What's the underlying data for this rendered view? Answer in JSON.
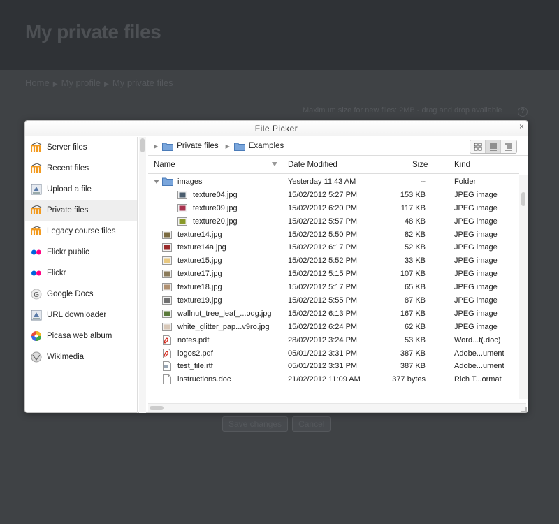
{
  "background": {
    "title": "My private files",
    "breadcrumb": [
      "Home",
      "My profile",
      "My private files"
    ],
    "max_size": "Maximum size for new files: 2MB - drag and drop available",
    "help": "?",
    "buttons": {
      "save": "Save changes",
      "cancel": "Cancel"
    }
  },
  "dialog": {
    "title": "File Picker",
    "close": "×"
  },
  "sidebar": {
    "items": [
      {
        "label": "Server files",
        "icon": "moodle-icon"
      },
      {
        "label": "Recent files",
        "icon": "moodle-icon"
      },
      {
        "label": "Upload a file",
        "icon": "upload-icon"
      },
      {
        "label": "Private files",
        "icon": "moodle-icon",
        "active": true
      },
      {
        "label": "Legacy course files",
        "icon": "moodle-icon"
      },
      {
        "label": "Flickr public",
        "icon": "flickr-icon"
      },
      {
        "label": "Flickr",
        "icon": "flickr-icon"
      },
      {
        "label": "Google Docs",
        "icon": "google-icon"
      },
      {
        "label": "URL downloader",
        "icon": "upload-icon"
      },
      {
        "label": "Picasa web album",
        "icon": "picasa-icon"
      },
      {
        "label": "Wikimedia",
        "icon": "wikimedia-icon"
      }
    ]
  },
  "path": [
    "Private files",
    "Examples"
  ],
  "columns": {
    "name": "Name",
    "date": "Date Modified",
    "size": "Size",
    "kind": "Kind"
  },
  "files": [
    {
      "name": "images",
      "date": "Yesterday 11:43 AM",
      "size": "--",
      "kind": "Folder",
      "type": "folder",
      "indent": 0,
      "expanded": true
    },
    {
      "name": "texture04.jpg",
      "date": "15/02/2012 5:27 PM",
      "size": "153 KB",
      "kind": "JPEG image",
      "type": "image",
      "indent": 1,
      "color": "#4a5d6e"
    },
    {
      "name": "texture09.jpg",
      "date": "15/02/2012 6:20 PM",
      "size": "117 KB",
      "kind": "JPEG image",
      "type": "image",
      "indent": 1,
      "color": "#a8324e"
    },
    {
      "name": "texture20.jpg",
      "date": "15/02/2012 5:57 PM",
      "size": "48 KB",
      "kind": "JPEG image",
      "type": "image",
      "indent": 1,
      "color": "#8a9a2a"
    },
    {
      "name": "texture14.jpg",
      "date": "15/02/2012 5:50 PM",
      "size": "82 KB",
      "kind": "JPEG image",
      "type": "image",
      "indent": 0,
      "color": "#7a6a40"
    },
    {
      "name": "texture14a.jpg",
      "date": "15/02/2012 6:17 PM",
      "size": "52 KB",
      "kind": "JPEG image",
      "type": "image",
      "indent": 0,
      "color": "#9a2a2a"
    },
    {
      "name": "texture15.jpg",
      "date": "15/02/2012 5:52 PM",
      "size": "33 KB",
      "kind": "JPEG image",
      "type": "image",
      "indent": 0,
      "color": "#e8c880"
    },
    {
      "name": "texture17.jpg",
      "date": "15/02/2012 5:15 PM",
      "size": "107 KB",
      "kind": "JPEG image",
      "type": "image",
      "indent": 0,
      "color": "#8a7a5a"
    },
    {
      "name": "texture18.jpg",
      "date": "15/02/2012 5:17 PM",
      "size": "65 KB",
      "kind": "JPEG image",
      "type": "image",
      "indent": 0,
      "color": "#b09070"
    },
    {
      "name": "texture19.jpg",
      "date": "15/02/2012 5:55 PM",
      "size": "87 KB",
      "kind": "JPEG image",
      "type": "image",
      "indent": 0,
      "color": "#707070"
    },
    {
      "name": "wallnut_tree_leaf_...oqg.jpg",
      "date": "15/02/2012 6:13 PM",
      "size": "167 KB",
      "kind": "JPEG image",
      "type": "image",
      "indent": 0,
      "color": "#5a7a3a"
    },
    {
      "name": "white_glitter_pap...v9ro.jpg",
      "date": "15/02/2012 6:24 PM",
      "size": "62 KB",
      "kind": "JPEG image",
      "type": "image",
      "indent": 0,
      "color": "#d8c8b8"
    },
    {
      "name": "notes.pdf",
      "date": "28/02/2012 3:24 PM",
      "size": "53 KB",
      "kind": "Word...t(.doc)",
      "type": "pdf",
      "indent": 0
    },
    {
      "name": "logos2.pdf",
      "date": "05/01/2012 3:31 PM",
      "size": "387 KB",
      "kind": "Adobe...ument",
      "type": "pdf",
      "indent": 0
    },
    {
      "name": "test_file.rtf",
      "date": "05/01/2012 3:31 PM",
      "size": "387 KB",
      "kind": "Adobe...ument",
      "type": "rtf",
      "indent": 0
    },
    {
      "name": "instructions.doc",
      "date": "21/02/2012 11:09 AM",
      "size": "377 bytes",
      "kind": "Rich T...ormat",
      "type": "doc",
      "indent": 0
    }
  ]
}
